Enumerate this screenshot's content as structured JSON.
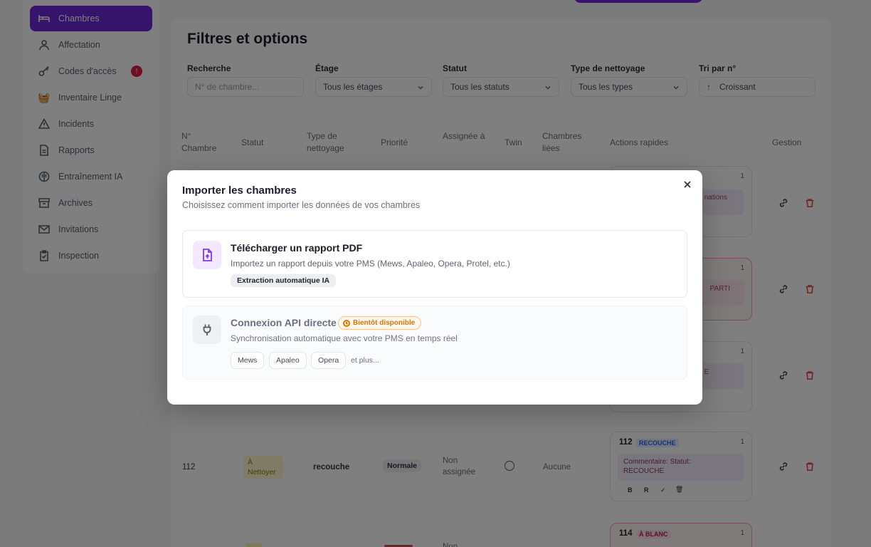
{
  "sidebar": {
    "items": [
      {
        "label": "Chambres",
        "icon": "bed-icon",
        "active": true
      },
      {
        "label": "Affectation",
        "icon": "user-icon"
      },
      {
        "label": "Codes d'accès",
        "icon": "key-icon",
        "badge": "!"
      },
      {
        "label": "Inventaire Linge",
        "icon": "basket-icon"
      },
      {
        "label": "Incidents",
        "icon": "alert-triangle-icon"
      },
      {
        "label": "Rapports",
        "icon": "file-icon"
      },
      {
        "label": "Entraînement IA",
        "icon": "brain-icon"
      },
      {
        "label": "Archives",
        "icon": "archive-icon"
      },
      {
        "label": "Invitations",
        "icon": "mail-icon"
      },
      {
        "label": "Inspection",
        "icon": "clipboard-icon"
      }
    ]
  },
  "main": {
    "title": "Filtres et options",
    "filters": {
      "search": {
        "label": "Recherche",
        "placeholder": "N° de chambre..."
      },
      "floor": {
        "label": "Étage",
        "value": "Tous les étages"
      },
      "status": {
        "label": "Statut",
        "value": "Tous les statuts"
      },
      "cleaning": {
        "label": "Type de nettoyage",
        "value": "Tous les types"
      },
      "sort": {
        "label": "Tri par n°",
        "value": "Croissant"
      }
    },
    "table": {
      "headers": [
        "N° Chambre",
        "Statut",
        "Type de nettoyage",
        "Priorité",
        "Assignée à",
        "Twin",
        "Chambres liées",
        "Actions rapides",
        "Gestion"
      ],
      "row_112": {
        "number": "112",
        "status": "À Nettoyer",
        "cleaning": "recouche",
        "priority": "Normale",
        "assigned": "Non assignée",
        "linked": "Aucune"
      },
      "cards": {
        "card1_text": "nations",
        "card2_text": "PARTI",
        "card3_text": "E",
        "card4_number": "112",
        "card4_tag": "RECOUCHE",
        "card4_count": "1",
        "card4_comment": "Commentaire: Statut: RECOUCHE",
        "card4_actions": [
          "B",
          "R",
          "✓",
          "🗑"
        ],
        "card5_number": "114",
        "card5_tag": "À BLANC",
        "card_counts": [
          "1",
          "1",
          "1",
          "1"
        ]
      },
      "next_row_assigned": "Non"
    }
  },
  "modal": {
    "title": "Importer les chambres",
    "subtitle": "Choisissez comment importer les données de vos chambres",
    "option_pdf": {
      "title": "Télécharger un rapport PDF",
      "description": "Importez un rapport depuis votre PMS (Mews, Apaleo, Opera, Protel, etc.)",
      "feature": "Extraction automatique IA"
    },
    "option_api": {
      "title": "Connexion API directe",
      "badge": "Bientôt disponible",
      "description": "Synchronisation automatique avec votre PMS en temps réel",
      "pms": [
        "Mews",
        "Apaleo",
        "Opera"
      ],
      "more": "et plus..."
    }
  },
  "colors": {
    "accent": "#6d28d9",
    "danger": "#e11d48",
    "warning": "#d97706"
  }
}
